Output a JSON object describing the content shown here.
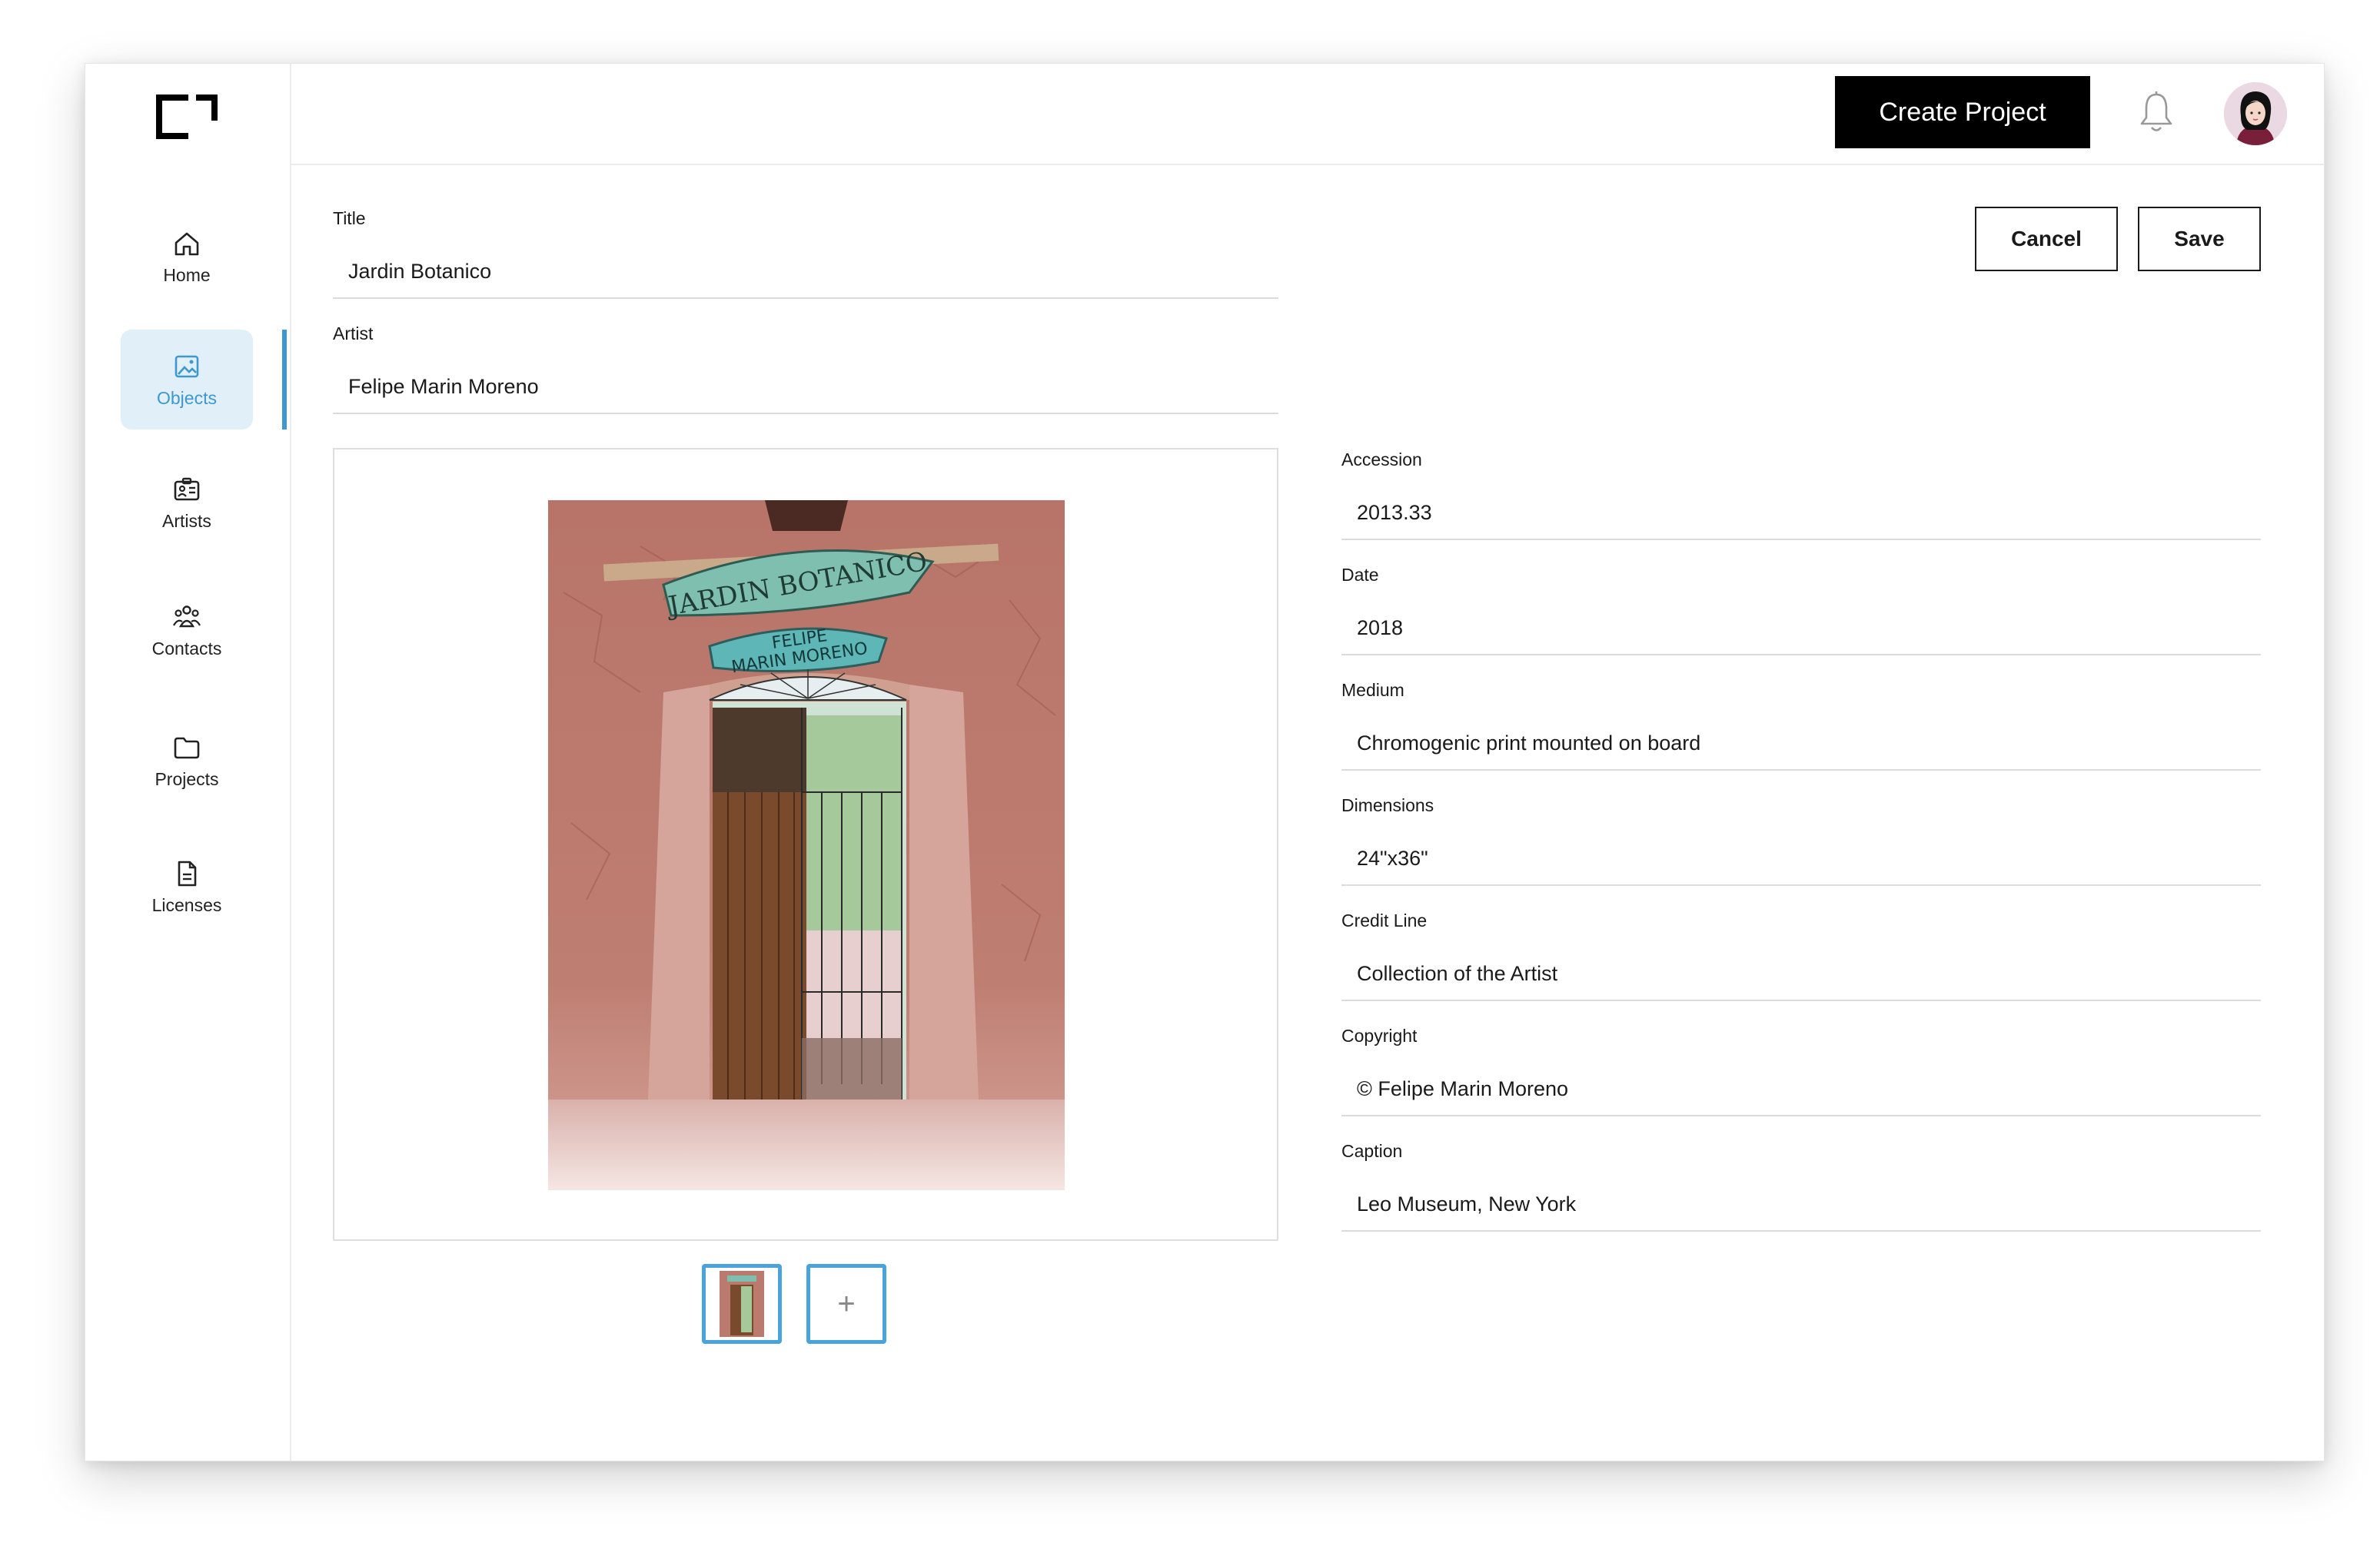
{
  "sidebar": {
    "items": [
      {
        "label": "Home",
        "icon": "home-icon"
      },
      {
        "label": "Objects",
        "icon": "image-icon",
        "active": true
      },
      {
        "label": "Artists",
        "icon": "id-card-icon"
      },
      {
        "label": "Contacts",
        "icon": "people-icon"
      },
      {
        "label": "Projects",
        "icon": "folder-icon"
      },
      {
        "label": "Licenses",
        "icon": "document-icon"
      }
    ]
  },
  "header": {
    "create_label": "Create Project"
  },
  "actions": {
    "cancel_label": "Cancel",
    "save_label": "Save"
  },
  "form": {
    "title": {
      "label": "Title",
      "value": "Jardin Botanico"
    },
    "artist": {
      "label": "Artist",
      "value": "Felipe Marin Moreno"
    },
    "accession": {
      "label": "Accession",
      "value": "2013.33"
    },
    "date": {
      "label": "Date",
      "value": "2018"
    },
    "medium": {
      "label": "Medium",
      "value": "Chromogenic print mounted on board"
    },
    "dimensions": {
      "label": "Dimensions",
      "value": "24\"x36\""
    },
    "credit_line": {
      "label": "Credit Line",
      "value": "Collection of the Artist"
    },
    "copyright": {
      "label": "Copyright",
      "value": "© Felipe Marin Moreno"
    },
    "caption": {
      "label": "Caption",
      "value": "Leo Museum, New York"
    }
  },
  "photo": {
    "sign_top": "JARDIN BOTANICO",
    "sign_bottom_line1": "FELIPE",
    "sign_bottom_line2": "MARIN MORENO"
  },
  "thumbnails": {
    "add_label": "+"
  },
  "colors": {
    "accent": "#3e97cf",
    "active_bg": "#e1f0f8",
    "primary_button": "#000000"
  }
}
